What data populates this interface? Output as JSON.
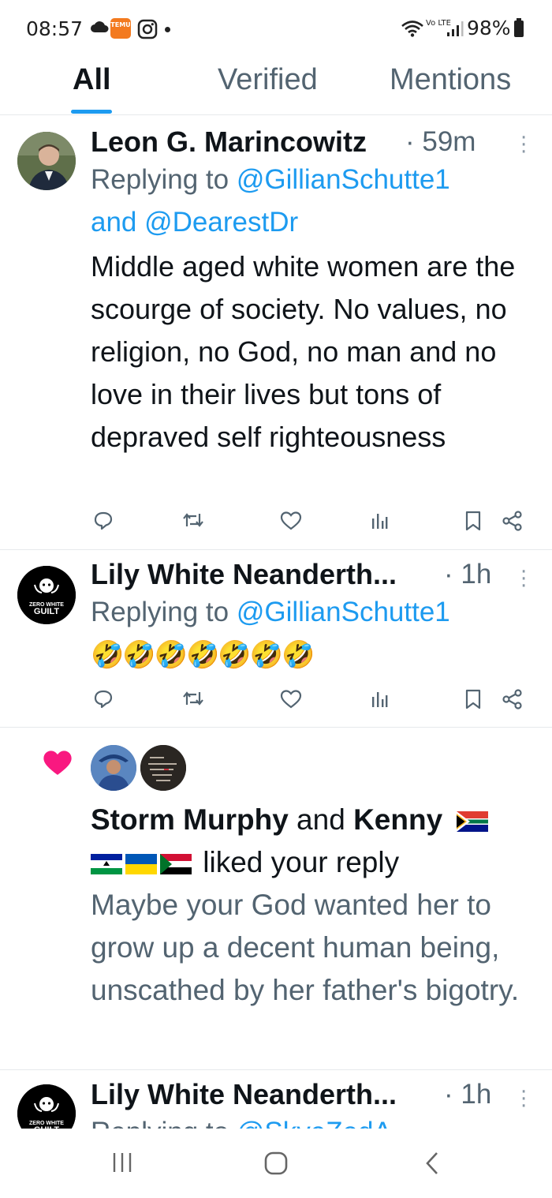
{
  "status_bar": {
    "time": "08:57",
    "temu_label": "TEMU",
    "volte": "Vo LTE",
    "battery": "98%"
  },
  "tabs": [
    {
      "label": "All",
      "active": true
    },
    {
      "label": "Verified",
      "active": false
    },
    {
      "label": "Mentions",
      "active": false
    }
  ],
  "posts": [
    {
      "name": "Leon G. Marincowitz",
      "time": "· 59m",
      "replying_prefix": "Replying to ",
      "mention1": "@GillianSchutte1",
      "and_word": "and ",
      "mention2": "@DearestDr",
      "text": "Middle aged white women are the scourge of society. No values, no religion, no God, no man and no love in their lives but tons of depraved self righteousness"
    },
    {
      "name": "Lily White Neanderth...",
      "time": "· 1h",
      "replying_prefix": "Replying to ",
      "mention1": "@GillianSchutte1",
      "text": "🤣🤣🤣🤣🤣🤣🤣"
    },
    {
      "name": "Lily White Neanderth...",
      "time": "· 1h",
      "replying_prefix": "Replying to ",
      "mention1": "@SkyeZedA"
    }
  ],
  "avatar_logo": {
    "line1": "ZERO WHITE",
    "line2": "GUILT"
  },
  "like_notification": {
    "user1": "Storm Murphy",
    "and_word": " and ",
    "user2": "Kenny",
    "action": " liked your reply",
    "quote": "Maybe your God wanted her to grow up a decent human being, unscathed by her father's bigotry."
  },
  "colors": {
    "accent": "#1d9bf0",
    "heart": "#f91880",
    "secondary_text": "#536471"
  }
}
